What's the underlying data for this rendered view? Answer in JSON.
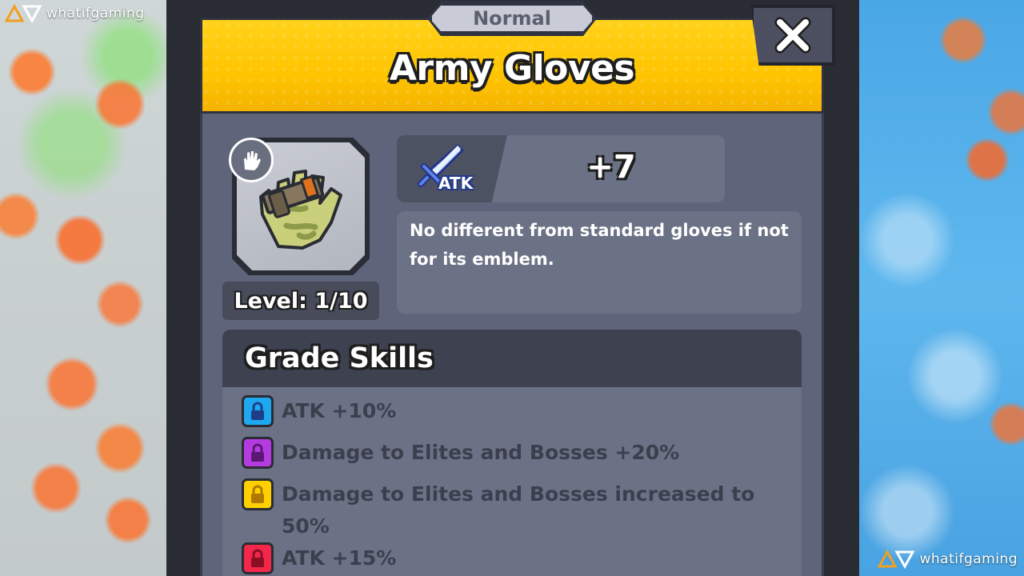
{
  "watermark": {
    "text": "whatifgaming"
  },
  "dialog": {
    "rarity": "Normal",
    "title": "Army Gloves",
    "close_icon": "close-icon"
  },
  "item": {
    "slot_icon": "glove-slot-icon",
    "art": "army-gloves-icon",
    "level_text": "Level: 1/10"
  },
  "stat": {
    "icon": "sword-icon",
    "label": "ATK",
    "value": "+7"
  },
  "description": "No different from standard gloves if not for its emblem.",
  "grade_skills": {
    "heading": "Grade Skills",
    "items": [
      {
        "text": "ATK +10%",
        "color": "#1ea8f0",
        "icon": "lock-icon"
      },
      {
        "text": "Damage to Elites and Bosses +20%",
        "color": "#b43be0",
        "icon": "lock-icon"
      },
      {
        "text": "Damage to Elites and Bosses increased to 50%",
        "color": "#ffd000",
        "icon": "lock-icon"
      },
      {
        "text": "ATK +15%",
        "color": "#f2274a",
        "icon": "lock-icon"
      }
    ]
  },
  "colors": {
    "header_yellow": "#ffc400",
    "panel": "#5e6479",
    "card": "#6c7286"
  }
}
